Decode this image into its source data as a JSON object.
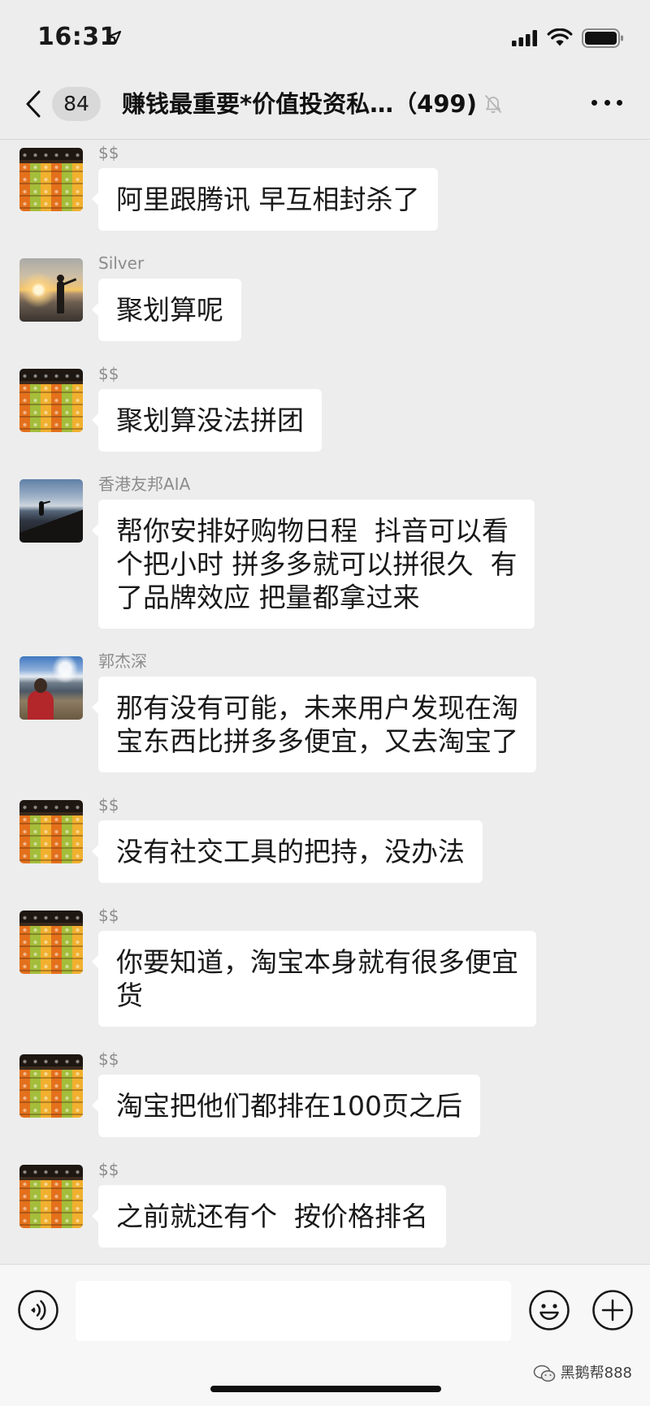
{
  "status_bar": {
    "time": "16:31",
    "icons": [
      "location-arrow-icon",
      "cellular-signal-icon",
      "wifi-icon",
      "battery-icon"
    ]
  },
  "nav": {
    "back_icon": "chevron-left-icon",
    "unread_count": "84",
    "title": "赚钱最重要*价值投资私…（499)",
    "mute_icon": "muted-bell-icon",
    "more_icon": "more-dots-icon"
  },
  "messages": [
    {
      "sender": "$$",
      "avatar": "juice-bottles-photo",
      "lines": [
        "阿里跟腾讯 早互相封杀了"
      ]
    },
    {
      "sender": "Silver",
      "avatar": "sunset-beach-photo",
      "lines": [
        "聚划算呢"
      ]
    },
    {
      "sender": "$$",
      "avatar": "juice-bottles-photo",
      "lines": [
        "聚划算没法拼团"
      ]
    },
    {
      "sender": "香港友邦AIA",
      "avatar": "seaside-rocks-photo",
      "lines": [
        "帮你安排好购物日程  抖音可以看",
        "个把小时 拼多多就可以拼很久  有",
        "了品牌效应 把量都拿过来"
      ]
    },
    {
      "sender": "郭杰深",
      "avatar": "mountain-portrait-photo",
      "lines": [
        "那有没有可能，未来用户发现在淘",
        "宝东西比拼多多便宜，又去淘宝了"
      ]
    },
    {
      "sender": "$$",
      "avatar": "juice-bottles-photo",
      "lines": [
        "没有社交工具的把持，没办法"
      ]
    },
    {
      "sender": "$$",
      "avatar": "juice-bottles-photo",
      "lines": [
        "你要知道，淘宝本身就有很多便宜",
        "货"
      ]
    },
    {
      "sender": "$$",
      "avatar": "juice-bottles-photo",
      "lines": [
        "淘宝把他们都排在100页之后"
      ]
    },
    {
      "sender": "$$",
      "avatar": "juice-bottles-photo",
      "lines": [
        "之前就还有个  按价格排名"
      ]
    }
  ],
  "input_bar": {
    "value": "",
    "voice_icon": "voice-icon",
    "emoji_icon": "emoji-icon",
    "more_icon": "plus-icon"
  },
  "watermark": {
    "icon": "wechat-icon",
    "text": "黑鹅帮888"
  },
  "colors": {
    "background": "#EDEDED",
    "bubble": "#FFFFFF",
    "sender_name": "#8C8C8C",
    "message_text": "#191919",
    "input_bar": "#F7F7F7"
  }
}
